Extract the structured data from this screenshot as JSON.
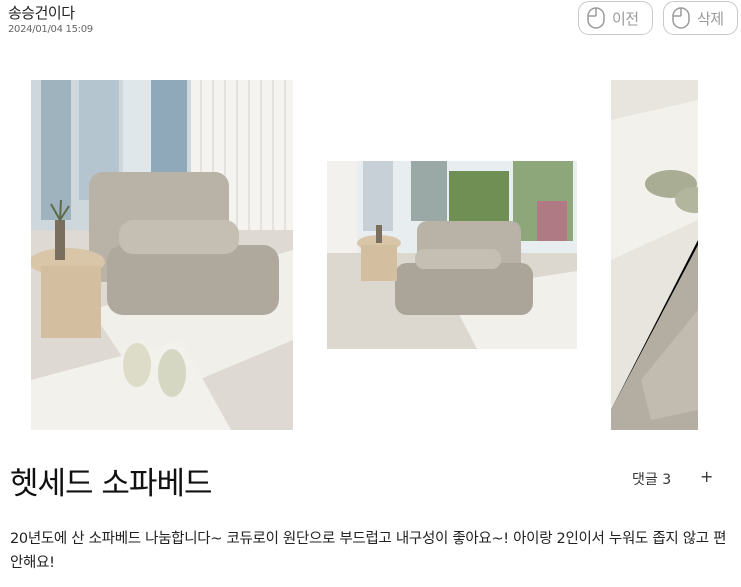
{
  "post": {
    "author": "송승건이다",
    "date": "2024/01/04 15:09",
    "title": "헷세드 소파베드",
    "description": "20년도에 산 소파베드 나눔합니다~ 코듀로이 원단으로 부드럽고 내구성이 좋아요~! 아이랑 2인이서 누워도 좁지 않고 편안해요!",
    "comments_label": "댓글 3",
    "add_icon": "+"
  },
  "actions": {
    "prev_label": "이전",
    "delete_label": "삭제"
  },
  "icons": {
    "prev": "mouse-icon",
    "delete": "mouse-icon"
  },
  "colors": {
    "button_border": "#c9c9c9",
    "button_text": "#9a9a9a",
    "sofa": "#b8b2a7"
  }
}
